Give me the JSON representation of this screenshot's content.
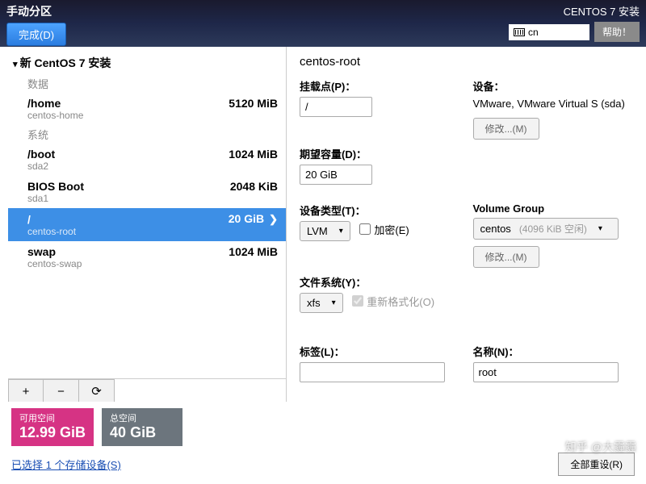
{
  "header": {
    "title": "手动分区",
    "done": "完成(D)",
    "subtitle": "CENTOS 7 安装",
    "keyboard": "cn",
    "help": "帮助！"
  },
  "tree": {
    "root": "新 CentOS 7 安装",
    "section_data": "数据",
    "section_system": "系统",
    "items": [
      {
        "name": "/home",
        "dev": "centos-home",
        "size": "5120 MiB"
      },
      {
        "name": "/boot",
        "dev": "sda2",
        "size": "1024 MiB"
      },
      {
        "name": "BIOS Boot",
        "dev": "sda1",
        "size": "2048 KiB"
      },
      {
        "name": "/",
        "dev": "centos-root",
        "size": "20 GiB"
      },
      {
        "name": "swap",
        "dev": "centos-swap",
        "size": "1024 MiB"
      }
    ]
  },
  "buttons": {
    "add": "+",
    "remove": "−",
    "reload": "⟳"
  },
  "detail": {
    "title": "centos-root",
    "mount_label": "挂载点(P)：",
    "mount_value": "/",
    "capacity_label": "期望容量(D)：",
    "capacity_value": "20 GiB",
    "device_label": "设备：",
    "device_text": "VMware, VMware Virtual S (sda)",
    "modify": "修改...(M)",
    "devtype_label": "设备类型(T)：",
    "devtype_value": "LVM",
    "encrypt": "加密(E)",
    "vg_label": "Volume Group",
    "vg_value": "centos",
    "vg_free": "(4096 KiB 空闲)",
    "fs_label": "文件系统(Y)：",
    "fs_value": "xfs",
    "reformat": "重新格式化(O)",
    "tag_label": "标签(L)：",
    "tag_value": "",
    "name_label": "名称(N)：",
    "name_value": "root"
  },
  "footer": {
    "avail_label": "可用空间",
    "avail_value": "12.99 GiB",
    "total_label": "总空间",
    "total_value": "40 GiB",
    "storage_link": "已选择 1 个存储设备(S)",
    "reset": "全部重设(R)"
  },
  "watermark": "知乎 @大霾霾"
}
